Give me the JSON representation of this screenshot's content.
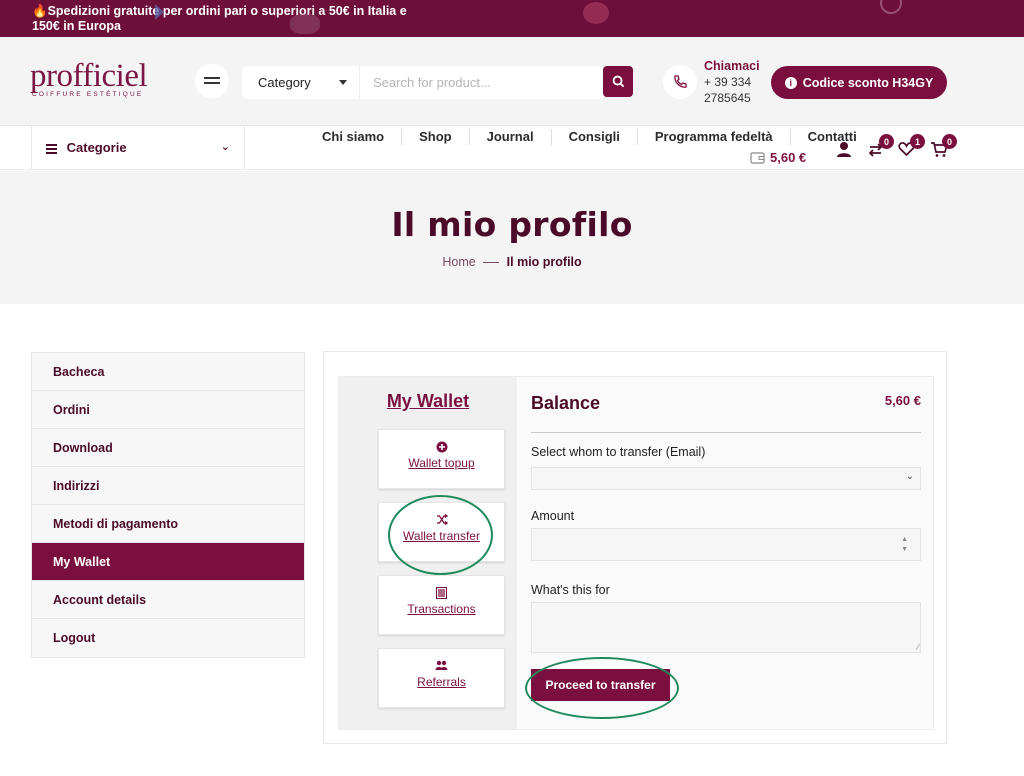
{
  "topbar": {
    "promo": "🔥Spedizioni gratuite per ordini pari o superiori a 50€ in Italia e 150€ in Europa"
  },
  "header": {
    "logo_word": "profficiel",
    "logo_tag": "COIFFURE ESTÉTIQUE",
    "category_label": "Category",
    "search_placeholder": "Search for product...",
    "call_title": "Chiamaci",
    "call_number_1": "+ 39 334",
    "call_number_2": "2785645",
    "promo_button": "Codice sconto H34GY"
  },
  "nav": {
    "categories": "Categorie",
    "links": [
      "Chi siamo",
      "Shop",
      "Journal",
      "Consigli",
      "Programma fedeltà",
      "Contatti"
    ],
    "wallet_amount": "5,60 €",
    "compare_count": "0",
    "wishlist_count": "1",
    "cart_count": "0"
  },
  "page": {
    "title": "Il mio profilo",
    "breadcrumb_home": "Home",
    "breadcrumb_current": "Il mio profilo"
  },
  "account_nav": [
    "Bacheca",
    "Ordini",
    "Download",
    "Indirizzi",
    "Metodi di pagamento",
    "My Wallet",
    "Account details",
    "Logout"
  ],
  "wallet": {
    "heading": "My Wallet",
    "cards": [
      "Wallet topup",
      "Wallet transfer",
      "Transactions",
      "Referrals"
    ],
    "balance_label": "Balance",
    "balance_value": "5,60 €",
    "select_label": "Select whom to transfer (Email)",
    "amount_label": "Amount",
    "note_label": "What's this for",
    "proceed_button": "Proceed to transfer"
  },
  "colors": {
    "brand": "#7a0f3f",
    "annotation": "#1f8a5b"
  }
}
